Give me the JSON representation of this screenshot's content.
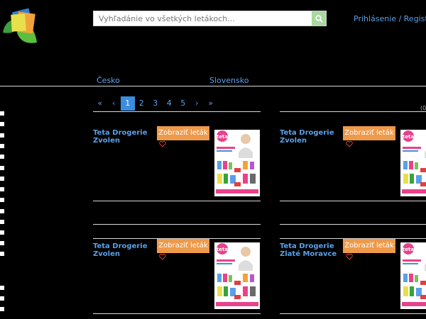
{
  "search": {
    "placeholder": "Vyhľadánie vo všetkých letákoch..."
  },
  "header": {
    "login_label": "Prihlásenie / Registrácia"
  },
  "countries": [
    "Česko",
    "Slovensko"
  ],
  "pagination": {
    "first": "«",
    "prev": "‹",
    "pages": [
      "1",
      "2",
      "3",
      "4",
      "5"
    ],
    "active_page": "1",
    "next": "›",
    "last": "»"
  },
  "result_count_fragment": "(0",
  "offers": [
    {
      "store": "Teta Drogerie Zvolen",
      "cta": "Zobraziť leták",
      "thumb_brand": "teta"
    },
    {
      "store": "Teta Drogerie Zvolen",
      "cta": "Zobraziť leták",
      "thumb_brand": "teta"
    },
    {
      "store": "Teta Drogerie Zvolen",
      "cta": "Zobraziť leták",
      "thumb_brand": "teta"
    },
    {
      "store": "Teta Drogerie Zlaté Moravce",
      "cta": "Zobraziť leták",
      "thumb_brand": "teta"
    }
  ],
  "colors": {
    "link": "#5aa0e8",
    "button": "#ee9a4a",
    "active_page": "#3a8de0",
    "search_button": "#a9d8a0",
    "heart": "#e04040"
  }
}
